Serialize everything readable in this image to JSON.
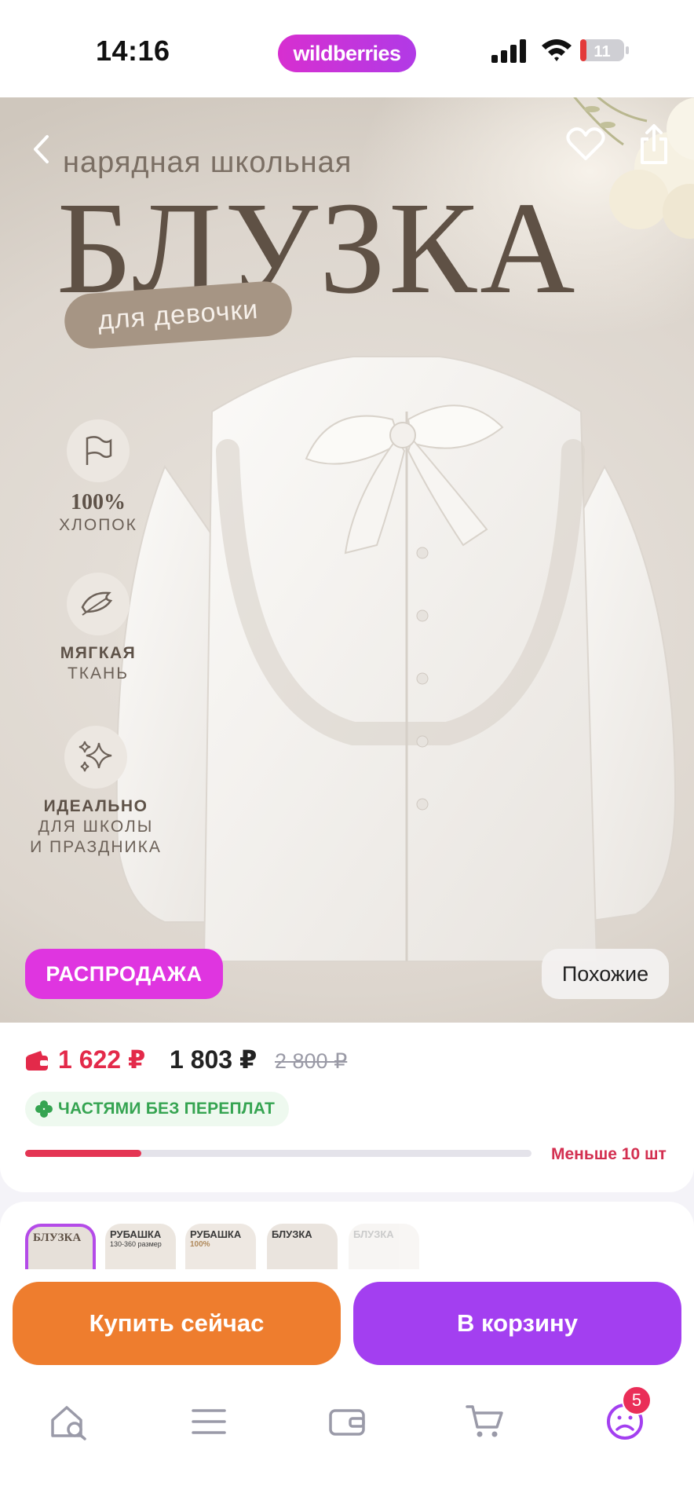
{
  "status_bar": {
    "time": "14:16",
    "brand": "wildberries",
    "battery": "11",
    "icons": [
      "signal-icon",
      "wifi-icon",
      "battery-icon"
    ]
  },
  "product_image": {
    "subtitle": "нарядная школьная",
    "title": "БЛУЗКА",
    "tag": "для девочки",
    "features": [
      {
        "icon": "flag-icon",
        "strong": "100%",
        "line": "ХЛОПОК"
      },
      {
        "icon": "feather-icon",
        "bold": "МЯГКАЯ",
        "line": "ТКАНЬ"
      },
      {
        "icon": "sparkle-icon",
        "bold": "ИДЕАЛЬНО",
        "line1": "ДЛЯ ШКОЛЫ",
        "line2": "И ПРАЗДНИКА"
      }
    ],
    "sale_label": "РАСПРОДАЖА",
    "similar_label": "Похожие"
  },
  "price": {
    "wallet_price": "1 622 ₽",
    "price": "1 803 ₽",
    "old_price": "2 800 ₽",
    "installments": "ЧАСТЯМИ БЕЗ ПЕРЕПЛАТ",
    "stock_text": "Меньше 10 шт",
    "stock_level": 0.23,
    "colors": {
      "wallet": "#e32a4a",
      "installments": "#35a451",
      "stock": "#e43553"
    }
  },
  "thumbnails": [
    {
      "label": "БЛУЗКА",
      "active": true
    },
    {
      "label": "РУБАШКА",
      "sub": "130-360 размер"
    },
    {
      "label": "РУБАШКА",
      "sub": "100%"
    },
    {
      "label": "БЛУЗКА",
      "sub": ""
    },
    {
      "label": "БЛУЗКА",
      "sub": ""
    }
  ],
  "actions": {
    "buy_now": "Купить сейчас",
    "add_to_cart": "В корзину",
    "colors": {
      "buy": "#ee7d2e",
      "cart": "#a33ff0"
    }
  },
  "tab_bar": {
    "items": [
      "home-search-icon",
      "catalog-menu-icon",
      "wallet-icon",
      "cart-icon",
      "profile-icon"
    ],
    "profile_badge": "5"
  }
}
